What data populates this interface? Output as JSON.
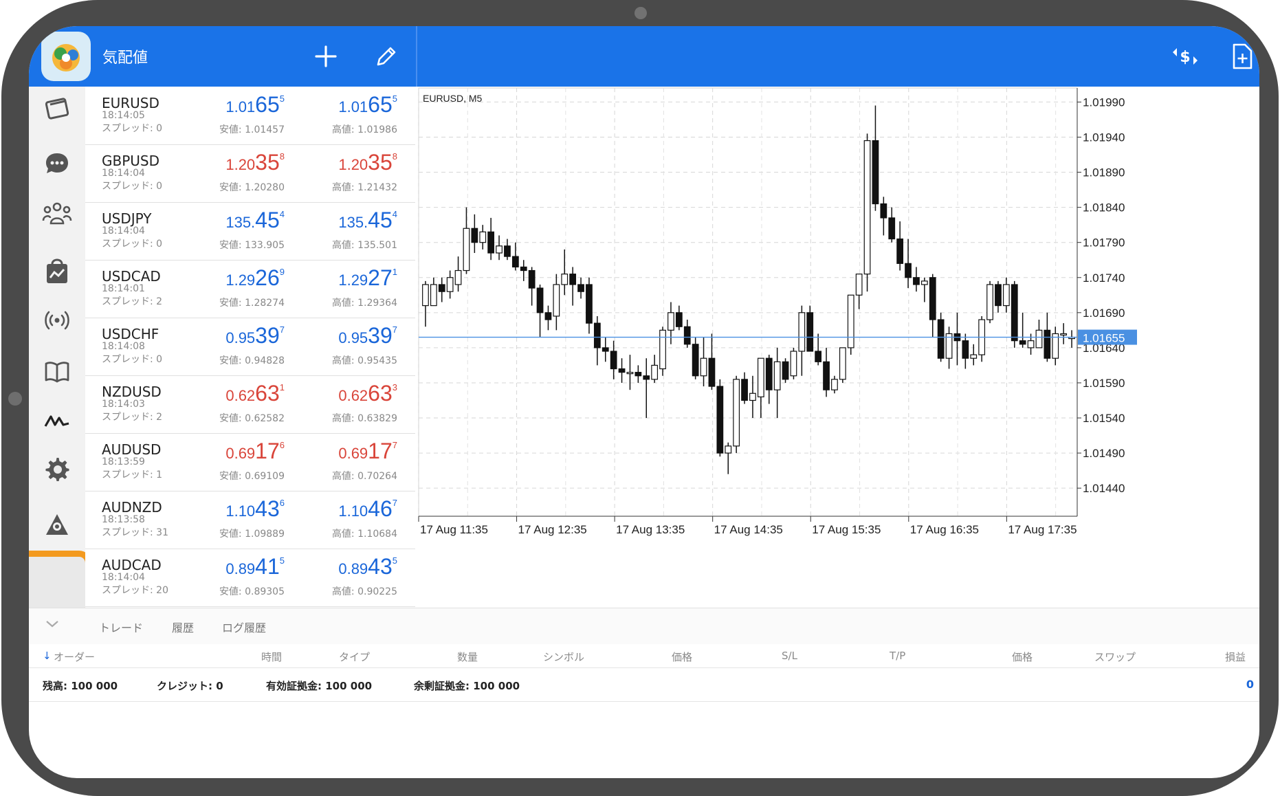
{
  "app": {
    "title": "気配値"
  },
  "quotes": [
    {
      "symbol": "EURUSD",
      "time": "18:14:05",
      "spread_label": "スプレッド: 0",
      "bid": {
        "a": "1.01",
        "b": "65",
        "c": "5"
      },
      "ask": {
        "a": "1.01",
        "b": "65",
        "c": "5"
      },
      "low": "安値: 1.01457",
      "high": "高値: 1.01986",
      "color": "#1a66d9"
    },
    {
      "symbol": "GBPUSD",
      "time": "18:14:04",
      "spread_label": "スプレッド: 0",
      "bid": {
        "a": "1.20",
        "b": "35",
        "c": "8"
      },
      "ask": {
        "a": "1.20",
        "b": "35",
        "c": "8"
      },
      "low": "安値: 1.20280",
      "high": "高値: 1.21432",
      "color": "#d9453a"
    },
    {
      "symbol": "USDJPY",
      "time": "18:14:04",
      "spread_label": "スプレッド: 0",
      "bid": {
        "a": "135.",
        "b": "45",
        "c": "4"
      },
      "ask": {
        "a": "135.",
        "b": "45",
        "c": "4"
      },
      "low": "安値: 133.905",
      "high": "高値: 135.501",
      "color": "#1a66d9"
    },
    {
      "symbol": "USDCAD",
      "time": "18:14:01",
      "spread_label": "スプレッド: 2",
      "bid": {
        "a": "1.29",
        "b": "26",
        "c": "9"
      },
      "ask": {
        "a": "1.29",
        "b": "27",
        "c": "1"
      },
      "low": "安値: 1.28274",
      "high": "高値: 1.29364",
      "color": "#1a66d9"
    },
    {
      "symbol": "USDCHF",
      "time": "18:14:08",
      "spread_label": "スプレッド: 0",
      "bid": {
        "a": "0.95",
        "b": "39",
        "c": "7"
      },
      "ask": {
        "a": "0.95",
        "b": "39",
        "c": "7"
      },
      "low": "安値: 0.94828",
      "high": "高値: 0.95435",
      "color": "#1a66d9"
    },
    {
      "symbol": "NZDUSD",
      "time": "18:14:03",
      "spread_label": "スプレッド: 2",
      "bid": {
        "a": "0.62",
        "b": "63",
        "c": "1"
      },
      "ask": {
        "a": "0.62",
        "b": "63",
        "c": "3"
      },
      "low": "安値: 0.62582",
      "high": "高値: 0.63829",
      "color": "#d9453a"
    },
    {
      "symbol": "AUDUSD",
      "time": "18:13:59",
      "spread_label": "スプレッド: 1",
      "bid": {
        "a": "0.69",
        "b": "17",
        "c": "6"
      },
      "ask": {
        "a": "0.69",
        "b": "17",
        "c": "7"
      },
      "low": "安値: 0.69109",
      "high": "高値: 0.70264",
      "color": "#d9453a"
    },
    {
      "symbol": "AUDNZD",
      "time": "18:13:58",
      "spread_label": "スプレッド: 31",
      "bid": {
        "a": "1.10",
        "b": "43",
        "c": "6"
      },
      "ask": {
        "a": "1.10",
        "b": "46",
        "c": "7"
      },
      "low": "安値: 1.09889",
      "high": "高値: 1.10684",
      "color": "#1a66d9"
    },
    {
      "symbol": "AUDCAD",
      "time": "18:14:04",
      "spread_label": "スプレッド: 20",
      "bid": {
        "a": "0.89",
        "b": "41",
        "c": "5"
      },
      "ask": {
        "a": "0.89",
        "b": "43",
        "c": "5"
      },
      "low": "安値: 0.89305",
      "high": "高値: 0.90225",
      "color": "#1a66d9"
    }
  ],
  "chart_data": {
    "type": "candlestick",
    "title": "EURUSD, M5",
    "current_price": "1.01655",
    "ylim": [
      1.014,
      1.0201
    ],
    "y_ticks": [
      "1.01990",
      "1.01940",
      "1.01890",
      "1.01840",
      "1.01790",
      "1.01740",
      "1.01690",
      "1.01640",
      "1.01590",
      "1.01540",
      "1.01490",
      "1.01440"
    ],
    "x_ticks": [
      "17 Aug 11:35",
      "17 Aug 12:35",
      "17 Aug 13:35",
      "17 Aug 14:35",
      "17 Aug 15:35",
      "17 Aug 16:35",
      "17 Aug 17:35"
    ],
    "candles": [
      [
        1.017,
        1.01735,
        1.0167,
        1.0173
      ],
      [
        1.017,
        1.0174,
        1.017,
        1.0173
      ],
      [
        1.0173,
        1.0174,
        1.01705,
        1.0172
      ],
      [
        1.0172,
        1.0175,
        1.0171,
        1.0174
      ],
      [
        1.0173,
        1.0177,
        1.0172,
        1.0175
      ],
      [
        1.0175,
        1.0184,
        1.01745,
        1.0181
      ],
      [
        1.0181,
        1.0183,
        1.01775,
        1.0179
      ],
      [
        1.0179,
        1.01815,
        1.0178,
        1.01805
      ],
      [
        1.01805,
        1.01825,
        1.01765,
        1.01775
      ],
      [
        1.01775,
        1.018,
        1.01765,
        1.01785
      ],
      [
        1.01785,
        1.01795,
        1.01765,
        1.0177
      ],
      [
        1.0177,
        1.0179,
        1.0175,
        1.01755
      ],
      [
        1.01755,
        1.01765,
        1.01735,
        1.0175
      ],
      [
        1.0175,
        1.01755,
        1.017,
        1.01725
      ],
      [
        1.01725,
        1.0173,
        1.01655,
        1.0169
      ],
      [
        1.0169,
        1.017,
        1.01665,
        1.0168
      ],
      [
        1.01685,
        1.01745,
        1.01665,
        1.0173
      ],
      [
        1.0173,
        1.0178,
        1.01715,
        1.01745
      ],
      [
        1.01745,
        1.01755,
        1.017,
        1.0173
      ],
      [
        1.0173,
        1.0174,
        1.0171,
        1.0172
      ],
      [
        1.0173,
        1.0174,
        1.0166,
        1.01675
      ],
      [
        1.01675,
        1.01685,
        1.01615,
        1.0164
      ],
      [
        1.0164,
        1.01655,
        1.0162,
        1.01635
      ],
      [
        1.01635,
        1.0165,
        1.01595,
        1.0161
      ],
      [
        1.0161,
        1.01625,
        1.0159,
        1.01605
      ],
      [
        1.01605,
        1.0163,
        1.0158,
        1.01605
      ],
      [
        1.01605,
        1.01615,
        1.0159,
        1.016
      ],
      [
        1.016,
        1.01625,
        1.0154,
        1.01595
      ],
      [
        1.01595,
        1.0163,
        1.0159,
        1.01615
      ],
      [
        1.0161,
        1.0167,
        1.016,
        1.01665
      ],
      [
        1.01665,
        1.01705,
        1.01645,
        1.0169
      ],
      [
        1.0169,
        1.017,
        1.01665,
        1.0167
      ],
      [
        1.0167,
        1.0168,
        1.0164,
        1.01645
      ],
      [
        1.01645,
        1.01655,
        1.01595,
        1.016
      ],
      [
        1.016,
        1.01655,
        1.01585,
        1.01625
      ],
      [
        1.01625,
        1.0166,
        1.0158,
        1.01585
      ],
      [
        1.01585,
        1.01595,
        1.01485,
        1.0149
      ],
      [
        1.0149,
        1.01505,
        1.0146,
        1.015
      ],
      [
        1.015,
        1.016,
        1.0149,
        1.01595
      ],
      [
        1.01595,
        1.01605,
        1.0156,
        1.01565
      ],
      [
        1.01565,
        1.016,
        1.0154,
        1.01575
      ],
      [
        1.0157,
        1.01625,
        1.0154,
        1.01625
      ],
      [
        1.01625,
        1.0163,
        1.0156,
        1.0158
      ],
      [
        1.0158,
        1.0164,
        1.0154,
        1.0162
      ],
      [
        1.0162,
        1.01625,
        1.0159,
        1.01595
      ],
      [
        1.016,
        1.0164,
        1.01595,
        1.01635
      ],
      [
        1.01635,
        1.017,
        1.016,
        1.0169
      ],
      [
        1.0169,
        1.017,
        1.01635,
        1.01635
      ],
      [
        1.01635,
        1.0166,
        1.01615,
        1.0162
      ],
      [
        1.0162,
        1.0164,
        1.0157,
        1.0158
      ],
      [
        1.0158,
        1.016,
        1.01575,
        1.01595
      ],
      [
        1.01595,
        1.0164,
        1.0159,
        1.0164
      ],
      [
        1.0164,
        1.0171,
        1.0163,
        1.01715
      ],
      [
        1.01715,
        1.01745,
        1.01695,
        1.01745
      ],
      [
        1.01745,
        1.01945,
        1.0172,
        1.01935
      ],
      [
        1.01935,
        1.01985,
        1.01835,
        1.01845
      ],
      [
        1.01845,
        1.01855,
        1.018,
        1.01825
      ],
      [
        1.01825,
        1.0184,
        1.0179,
        1.01795
      ],
      [
        1.01795,
        1.0182,
        1.0175,
        1.0176
      ],
      [
        1.0176,
        1.01795,
        1.01725,
        1.0174
      ],
      [
        1.0174,
        1.01755,
        1.0172,
        1.0173
      ],
      [
        1.0173,
        1.0174,
        1.01705,
        1.01735
      ],
      [
        1.0174,
        1.01745,
        1.01655,
        1.0168
      ],
      [
        1.0168,
        1.0169,
        1.0162,
        1.01625
      ],
      [
        1.01625,
        1.0167,
        1.0161,
        1.0166
      ],
      [
        1.0166,
        1.0169,
        1.01615,
        1.0165
      ],
      [
        1.0165,
        1.0166,
        1.0161,
        1.01625
      ],
      [
        1.01625,
        1.01645,
        1.01615,
        1.0163
      ],
      [
        1.0163,
        1.01685,
        1.0162,
        1.0168
      ],
      [
        1.0168,
        1.01735,
        1.01675,
        1.0173
      ],
      [
        1.0173,
        1.01735,
        1.0169,
        1.017
      ],
      [
        1.017,
        1.0174,
        1.0169,
        1.0173
      ],
      [
        1.0173,
        1.01735,
        1.0164,
        1.0165
      ],
      [
        1.0165,
        1.0169,
        1.0164,
        1.01645
      ],
      [
        1.0164,
        1.0166,
        1.0163,
        1.0165
      ],
      [
        1.0164,
        1.0168,
        1.0164,
        1.01665
      ],
      [
        1.01665,
        1.0169,
        1.0162,
        1.01625
      ],
      [
        1.01625,
        1.0167,
        1.01615,
        1.0166
      ],
      [
        1.0166,
        1.01675,
        1.01645,
        1.0166
      ],
      [
        1.01655,
        1.01665,
        1.0164,
        1.01655
      ]
    ]
  },
  "tabs": {
    "trade": "トレード",
    "history": "履歴",
    "log": "ログ履歴"
  },
  "columns": {
    "order": "オーダー",
    "time": "時間",
    "type": "タイプ",
    "volume": "数量",
    "symbol": "シンボル",
    "price": "価格",
    "sl": "S/L",
    "tp": "T/P",
    "price2": "価格",
    "swap": "スワップ",
    "profit": "損益"
  },
  "summary": {
    "balance": "残高:  100 000",
    "credit": "クレジット:  0",
    "equity": "有効証拠金:  100 000",
    "free_margin": "余剰証拠金:  100 000",
    "total": "0"
  },
  "colors": {
    "accent": "#1a73e8",
    "up": "#1a66d9",
    "down": "#d9453a",
    "highlight": "#f39a1f"
  }
}
